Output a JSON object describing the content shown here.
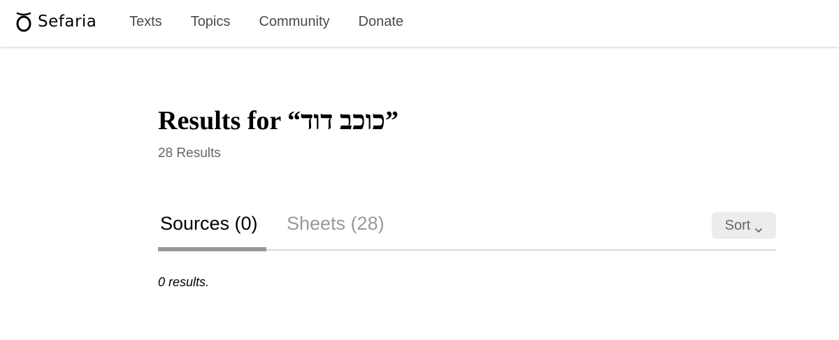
{
  "header": {
    "logo_text": "Sefaria",
    "logo_icon": "sefaria-logo-icon",
    "nav": [
      {
        "label": "Texts"
      },
      {
        "label": "Topics"
      },
      {
        "label": "Community"
      },
      {
        "label": "Donate"
      }
    ]
  },
  "search": {
    "title": "Results for “כוכב דוד”",
    "count_label": "28 Results",
    "tabs": [
      {
        "label": "Sources (0)",
        "active": true
      },
      {
        "label": "Sheets (28)",
        "active": false
      }
    ],
    "sort_label": "Sort",
    "sort_icon": "chevron-down-icon",
    "empty_message": "0 results."
  },
  "colors": {
    "active_tab": "#000000",
    "inactive_tab": "#999999",
    "tab_underline": "#999999",
    "sort_bg": "#ececec"
  }
}
